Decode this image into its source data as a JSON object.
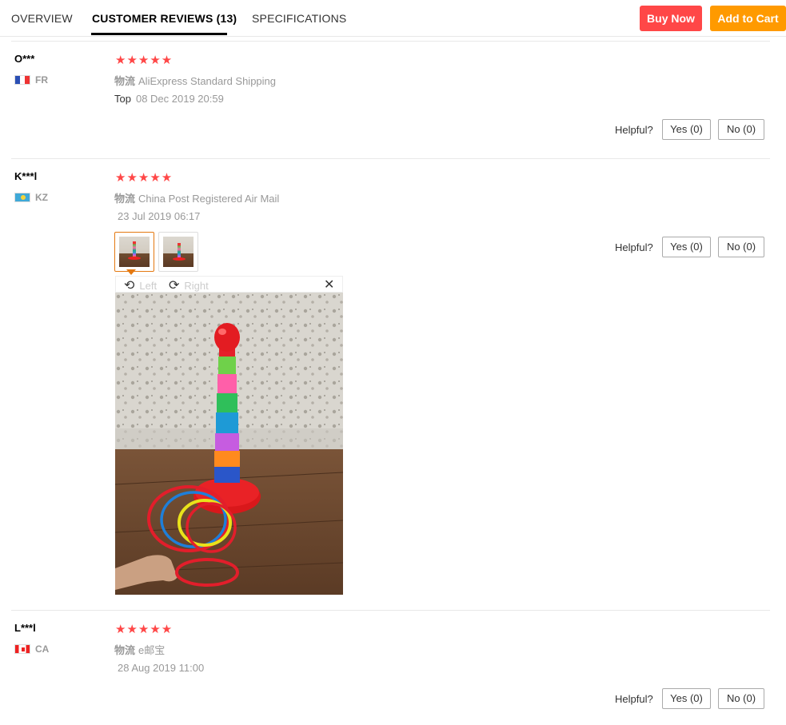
{
  "tabs": [
    {
      "label": "OVERVIEW"
    },
    {
      "label": "CUSTOMER REVIEWS (13)"
    },
    {
      "label": "SPECIFICATIONS"
    }
  ],
  "actions": {
    "buy_now": "Buy Now",
    "add_to_cart": "Add to Cart"
  },
  "colors": {
    "accent_red": "#ff4747",
    "accent_orange": "#ff9a00",
    "selected_thumb": "#e47911"
  },
  "reviews": [
    {
      "user": "O***",
      "country": "FR",
      "stars": "★★★★★",
      "shipping_key": "物流",
      "shipping": "AliExpress Standard Shipping",
      "top_label": "Top",
      "date": "08 Dec 2019 20:59",
      "helpful": "Helpful?",
      "yes": "Yes (0)",
      "no": "No (0)"
    },
    {
      "user": "K***l",
      "country": "KZ",
      "stars": "★★★★★",
      "shipping_key": "物流",
      "shipping": "China Post Registered Air Mail",
      "date": "23 Jul 2019 06:17",
      "helpful": "Helpful?",
      "yes": "Yes (0)",
      "no": "No (0)",
      "viewer": {
        "left": "Left",
        "right": "Right",
        "close": "✕"
      }
    },
    {
      "user": "L***l",
      "country": "CA",
      "stars": "★★★★★",
      "shipping_key": "物流",
      "shipping": "e邮宝",
      "date": "28 Aug 2019 11:00",
      "helpful": "Helpful?",
      "yes": "Yes (0)",
      "no": "No (0)"
    }
  ]
}
